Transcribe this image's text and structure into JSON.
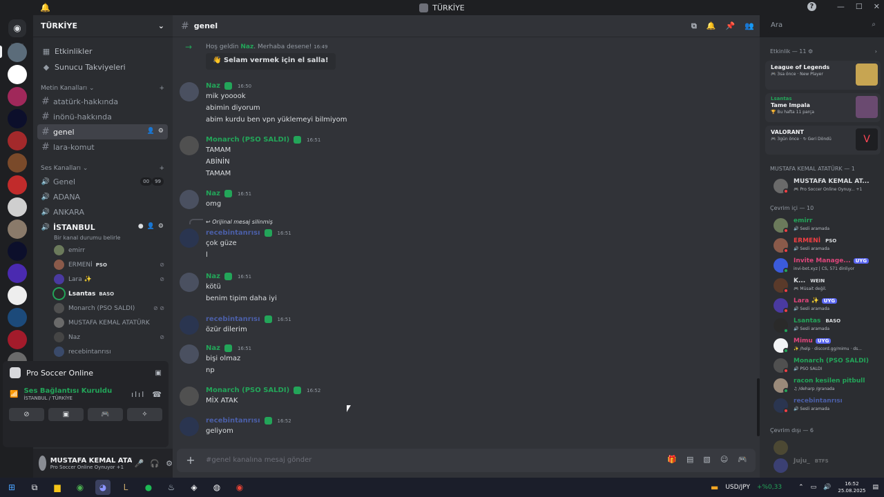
{
  "window": {
    "title": "TÜRKİYE"
  },
  "server": {
    "name": "TÜRKİYE",
    "top_items": [
      {
        "label": "Etkinlikler"
      },
      {
        "label": "Sunucu Takviyeleri"
      }
    ],
    "text_category": "Metin Kanalları",
    "text_channels": [
      "atatürk-hakkında",
      "inönü-hakkında",
      "genel",
      "lara-komut"
    ],
    "voice_category": "Ses Kanalları",
    "voice_channels": [
      "Genel",
      "ADANA",
      "ANKARA",
      "İSTANBUL"
    ],
    "genel_counts": [
      "00",
      "99"
    ],
    "istanbul_status": "Bir kanal durumu belirle",
    "voice_users": [
      {
        "name": "emirr",
        "tag": ""
      },
      {
        "name": "ERMENİ",
        "tag": "PSO"
      },
      {
        "name": "Lara ✨",
        "tag": ""
      },
      {
        "name": "Lsantas",
        "tag": "BASO"
      },
      {
        "name": "Monarch (PSO SALDI)",
        "tag": ""
      },
      {
        "name": "MUSTAFA KEMAL ATATÜRK",
        "tag": ""
      },
      {
        "name": "Naz",
        "tag": ""
      },
      {
        "name": "recebintanrısı",
        "tag": ""
      }
    ]
  },
  "voice_panel": {
    "activity": "Pro Soccer Online",
    "status": "Ses Bağlantısı Kuruldu",
    "location": "İSTANBUL / TÜRKİYE"
  },
  "user_panel": {
    "name": "MUSTAFA KEMAL ATAT...",
    "status": "Pro Soccer Online Oynuyor +1"
  },
  "channel": {
    "name": "genel",
    "composer_placeholder": "#genel kanalına mesaj gönder"
  },
  "search": {
    "placeholder": "Ara"
  },
  "messages": {
    "welcome_pre": "Hoş geldin",
    "welcome_name": "Naz",
    "welcome_post": ". Merhaba desene!",
    "welcome_time": "16:49",
    "wave_label": "Selam vermek için el salla!",
    "m1": {
      "author": "Naz",
      "time": "16:50",
      "lines": [
        "mik yooook",
        "abimin diyorum",
        "abim kurdu ben vpn yüklemeyi bilmiyom"
      ]
    },
    "m2": {
      "author": "Monarch (PSO SALDI)",
      "time": "16:51",
      "lines": [
        "TAMAM",
        "ABİNİN",
        "TAMAM"
      ]
    },
    "m3": {
      "author": "Naz",
      "time": "16:51",
      "lines": [
        "omg"
      ]
    },
    "m4": {
      "reply": "Orijinal mesaj silinmiş",
      "author": "recebintanrısı",
      "time": "16:51",
      "lines": [
        "çok güze",
        "l"
      ]
    },
    "m5": {
      "author": "Naz",
      "time": "16:51",
      "lines": [
        "kötü",
        "benim tipim daha iyi"
      ]
    },
    "m6": {
      "author": "recebintanrısı",
      "time": "16:51",
      "lines": [
        "özür dilerim"
      ]
    },
    "m7": {
      "author": "Naz",
      "time": "16:51",
      "lines": [
        "bişi olmaz",
        "np"
      ]
    },
    "m8": {
      "author": "Monarch (PSO SALDI)",
      "time": "16:52",
      "lines": [
        "MİX ATAK"
      ]
    },
    "m9": {
      "author": "recebintanrısı",
      "time": "16:52",
      "lines": [
        "geliyom"
      ]
    }
  },
  "activity": {
    "header": "Etkinlik — 11",
    "cards": [
      {
        "user": "",
        "game": "League of Legends",
        "meta": "3sa önce",
        "meta2": "New Player"
      },
      {
        "user": "Lsantas",
        "game": "Tame Impala",
        "meta": "Bu hafta 11 parça",
        "meta2": ""
      },
      {
        "user": "",
        "game": "VALORANT",
        "meta": "3gün önce",
        "meta2": "Geri Döndü"
      }
    ]
  },
  "members": {
    "group1": "MUSTAFA KEMAL ATATÜRK — 1",
    "self": {
      "name": "MUSTAFA KEMAL AT...",
      "status": "Pro Soccer Online Oynuy...",
      "extra": "+1"
    },
    "group2": "Çevrim içi — 10",
    "online": [
      {
        "name": "emirr",
        "tag": "",
        "status": "Sesli aramada"
      },
      {
        "name": "ERMENİ",
        "tag": "PSO",
        "status": "Sesli aramada"
      },
      {
        "name": "Invite Manage...",
        "tag": "UYG",
        "status": "invi-bot.xyz | CS, 571 dinliyor"
      },
      {
        "name": "K...",
        "tag": "WEIN",
        "status": "Müsait değil."
      },
      {
        "name": "Lara ✨",
        "tag": "UYG",
        "status": "Sesli aramada"
      },
      {
        "name": "Lsantas",
        "tag": "BASO",
        "status": "Sesli aramada"
      },
      {
        "name": "Mimu",
        "tag": "UYG",
        "status": "/help · discord.gg/mimu · ds..."
      },
      {
        "name": "Monarch (PSO SALDI)",
        "tag": "",
        "status": "PSO SALDI"
      },
      {
        "name": "racon kesilen pitbull",
        "tag": "",
        "status": "/deharp /granada"
      },
      {
        "name": "recebintanrısı",
        "tag": "",
        "status": "Sesli aramada"
      }
    ],
    "group3": "Çevrim dışı — 6",
    "offline": [
      {
        "name": "",
        "tag": ""
      },
      {
        "name": "Juju_",
        "tag": "BTFS"
      }
    ]
  },
  "taskbar": {
    "ticker": "USD/JPY",
    "ticker_change": "+%0,33",
    "time": "16:52",
    "date": "25.08.2025"
  },
  "colors": {
    "accent": "#5865f2",
    "online": "#23a559",
    "dnd": "#f23f43",
    "bg": "#313338"
  }
}
